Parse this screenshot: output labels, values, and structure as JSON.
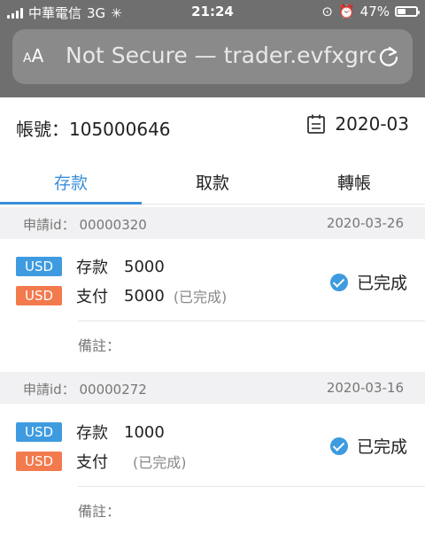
{
  "status_bar": {
    "carrier": "中華電信",
    "network": "3G",
    "time": "21:24",
    "battery": "47%",
    "battery_level": 0.47
  },
  "browser": {
    "aa_label": "AA",
    "url_text": "Not Secure — trader.evfxgro",
    "reload_icon": "reload-icon"
  },
  "account": {
    "label": "帳號：",
    "number": "105000646"
  },
  "month": "2020-03",
  "tabs": [
    {
      "label": "存款",
      "active": true
    },
    {
      "label": "取款",
      "active": false
    },
    {
      "label": "轉帳",
      "active": false
    }
  ],
  "records": [
    {
      "id_label": "申請id：",
      "id": "00000320",
      "date": "2020-03-26",
      "deposit": {
        "currency": "USD",
        "type": "存款",
        "amount": "5000"
      },
      "payment": {
        "currency": "USD",
        "type": "支付",
        "amount": "5000",
        "note": "(已完成)"
      },
      "status": "已完成",
      "remark_label": "備註："
    },
    {
      "id_label": "申請id：",
      "id": "00000272",
      "date": "2020-03-16",
      "deposit": {
        "currency": "USD",
        "type": "存款",
        "amount": "1000"
      },
      "payment": {
        "currency": "USD",
        "type": "支付",
        "amount": "",
        "note": "(已完成)"
      },
      "status": "已完成",
      "remark_label": "備註："
    }
  ],
  "colors": {
    "accent": "#3a8fd9",
    "badge_blue": "#3e9be0",
    "badge_orange": "#f27a4d",
    "chrome_bg": "#6f6f6f"
  }
}
